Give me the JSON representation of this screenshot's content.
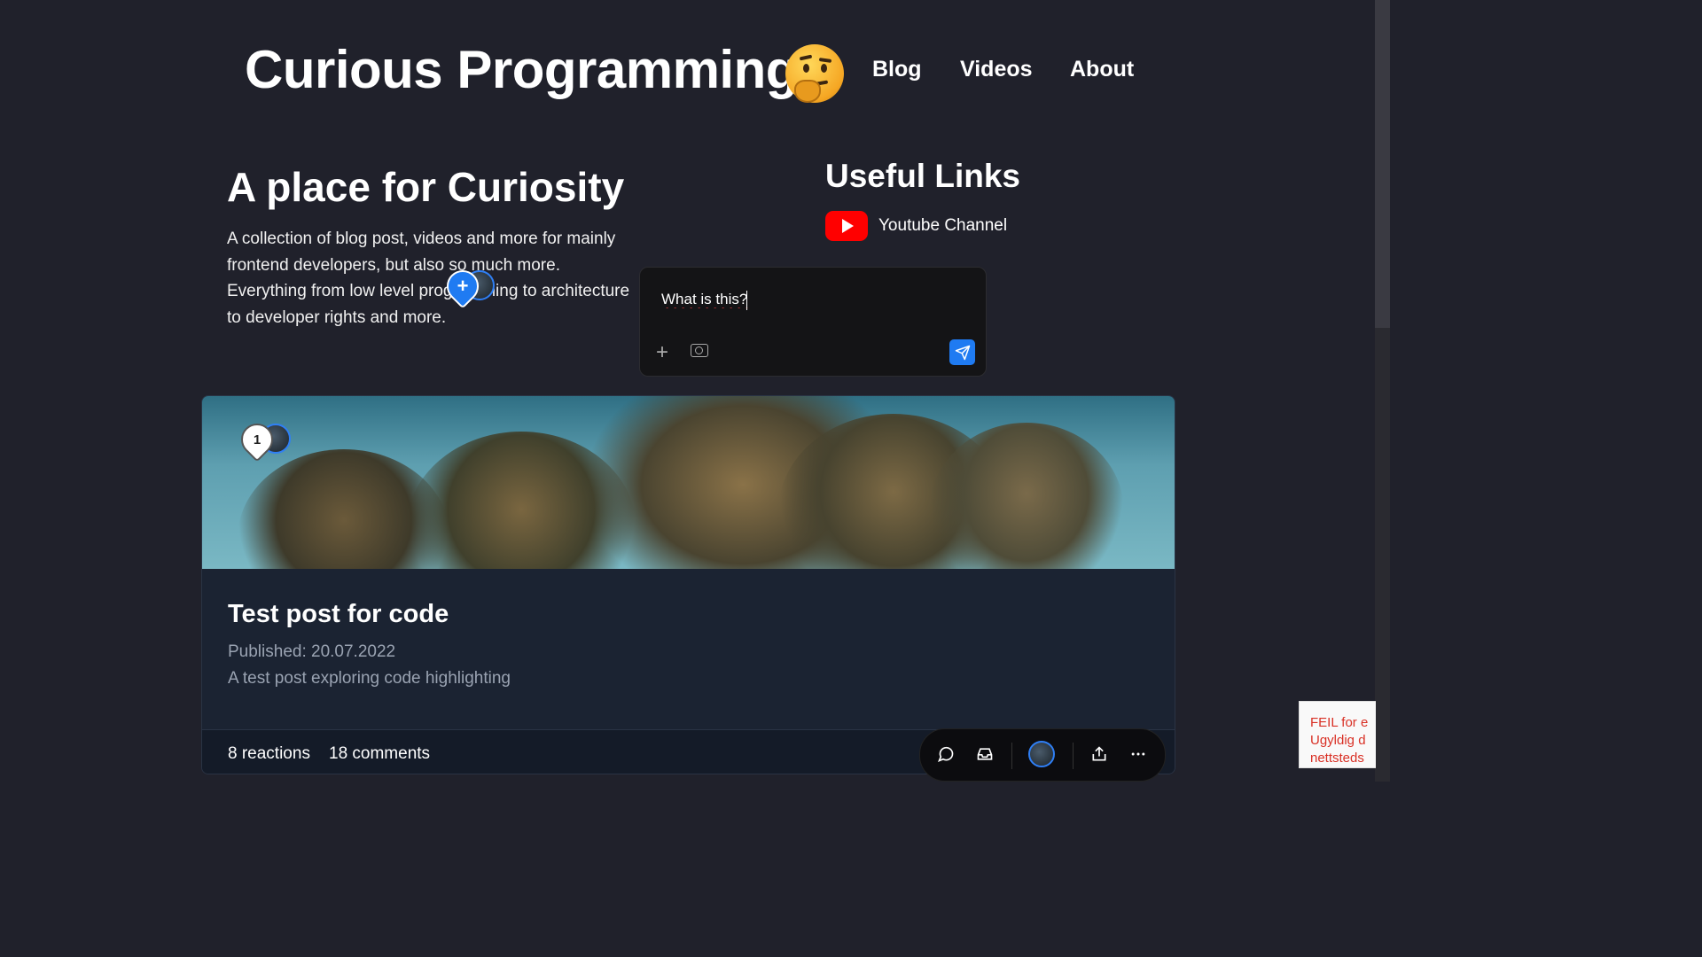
{
  "header": {
    "title": "Curious Programming",
    "emoji_icon": "thinking-face-icon",
    "nav": [
      "Blog",
      "Videos",
      "About"
    ]
  },
  "hero": {
    "title": "A place for Curiosity",
    "text": "A collection of blog post, videos and more for mainly frontend developers, but also so much more. Everything from low level programming to architecture to developer rights and more."
  },
  "useful_links": {
    "title": "Useful Links",
    "items": [
      {
        "label": "Youtube Channel",
        "icon": "youtube-icon"
      }
    ]
  },
  "comment_box": {
    "value": "What is this?",
    "add_icon": "plus-icon",
    "camera_icon": "camera-icon",
    "send_icon": "send-icon"
  },
  "comment_pins": [
    {
      "label": "+",
      "icon": "add-comment-icon"
    },
    {
      "label": "1",
      "icon": "comment-pin-icon"
    }
  ],
  "post": {
    "title": "Test post for code",
    "published": "Published: 20.07.2022",
    "description": "A test post exploring code highlighting",
    "reactions": "8 reactions",
    "comments": "18 comments"
  },
  "toolbar": {
    "icons": [
      "comment-icon",
      "inbox-icon",
      "avatar",
      "share-icon",
      "more-icon"
    ]
  },
  "recaptcha": {
    "lines": [
      "FEIL for e",
      "Ugyldig d",
      "nettsteds"
    ]
  },
  "colors": {
    "background": "#20212b",
    "card": "#1b2332",
    "accent": "#1f7bf2",
    "youtube": "#ff0000",
    "error": "#d93025"
  }
}
